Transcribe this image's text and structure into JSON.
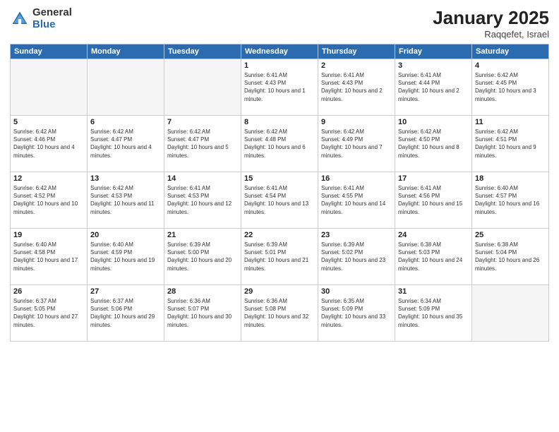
{
  "logo": {
    "general": "General",
    "blue": "Blue"
  },
  "title": {
    "month": "January 2025",
    "location": "Raqqefet, Israel"
  },
  "weekdays": [
    "Sunday",
    "Monday",
    "Tuesday",
    "Wednesday",
    "Thursday",
    "Friday",
    "Saturday"
  ],
  "weeks": [
    [
      {
        "day": "",
        "empty": true
      },
      {
        "day": "",
        "empty": true
      },
      {
        "day": "",
        "empty": true
      },
      {
        "day": "1",
        "sunrise": "6:41 AM",
        "sunset": "4:43 PM",
        "daylight": "10 hours and 1 minute."
      },
      {
        "day": "2",
        "sunrise": "6:41 AM",
        "sunset": "4:43 PM",
        "daylight": "10 hours and 2 minutes."
      },
      {
        "day": "3",
        "sunrise": "6:41 AM",
        "sunset": "4:44 PM",
        "daylight": "10 hours and 2 minutes."
      },
      {
        "day": "4",
        "sunrise": "6:42 AM",
        "sunset": "4:45 PM",
        "daylight": "10 hours and 3 minutes."
      }
    ],
    [
      {
        "day": "5",
        "sunrise": "6:42 AM",
        "sunset": "4:46 PM",
        "daylight": "10 hours and 4 minutes."
      },
      {
        "day": "6",
        "sunrise": "6:42 AM",
        "sunset": "4:47 PM",
        "daylight": "10 hours and 4 minutes."
      },
      {
        "day": "7",
        "sunrise": "6:42 AM",
        "sunset": "4:47 PM",
        "daylight": "10 hours and 5 minutes."
      },
      {
        "day": "8",
        "sunrise": "6:42 AM",
        "sunset": "4:48 PM",
        "daylight": "10 hours and 6 minutes."
      },
      {
        "day": "9",
        "sunrise": "6:42 AM",
        "sunset": "4:49 PM",
        "daylight": "10 hours and 7 minutes."
      },
      {
        "day": "10",
        "sunrise": "6:42 AM",
        "sunset": "4:50 PM",
        "daylight": "10 hours and 8 minutes."
      },
      {
        "day": "11",
        "sunrise": "6:42 AM",
        "sunset": "4:51 PM",
        "daylight": "10 hours and 9 minutes."
      }
    ],
    [
      {
        "day": "12",
        "sunrise": "6:42 AM",
        "sunset": "4:52 PM",
        "daylight": "10 hours and 10 minutes."
      },
      {
        "day": "13",
        "sunrise": "6:42 AM",
        "sunset": "4:53 PM",
        "daylight": "10 hours and 11 minutes."
      },
      {
        "day": "14",
        "sunrise": "6:41 AM",
        "sunset": "4:53 PM",
        "daylight": "10 hours and 12 minutes."
      },
      {
        "day": "15",
        "sunrise": "6:41 AM",
        "sunset": "4:54 PM",
        "daylight": "10 hours and 13 minutes."
      },
      {
        "day": "16",
        "sunrise": "6:41 AM",
        "sunset": "4:55 PM",
        "daylight": "10 hours and 14 minutes."
      },
      {
        "day": "17",
        "sunrise": "6:41 AM",
        "sunset": "4:56 PM",
        "daylight": "10 hours and 15 minutes."
      },
      {
        "day": "18",
        "sunrise": "6:40 AM",
        "sunset": "4:57 PM",
        "daylight": "10 hours and 16 minutes."
      }
    ],
    [
      {
        "day": "19",
        "sunrise": "6:40 AM",
        "sunset": "4:58 PM",
        "daylight": "10 hours and 17 minutes."
      },
      {
        "day": "20",
        "sunrise": "6:40 AM",
        "sunset": "4:59 PM",
        "daylight": "10 hours and 19 minutes."
      },
      {
        "day": "21",
        "sunrise": "6:39 AM",
        "sunset": "5:00 PM",
        "daylight": "10 hours and 20 minutes."
      },
      {
        "day": "22",
        "sunrise": "6:39 AM",
        "sunset": "5:01 PM",
        "daylight": "10 hours and 21 minutes."
      },
      {
        "day": "23",
        "sunrise": "6:39 AM",
        "sunset": "5:02 PM",
        "daylight": "10 hours and 23 minutes."
      },
      {
        "day": "24",
        "sunrise": "6:38 AM",
        "sunset": "5:03 PM",
        "daylight": "10 hours and 24 minutes."
      },
      {
        "day": "25",
        "sunrise": "6:38 AM",
        "sunset": "5:04 PM",
        "daylight": "10 hours and 26 minutes."
      }
    ],
    [
      {
        "day": "26",
        "sunrise": "6:37 AM",
        "sunset": "5:05 PM",
        "daylight": "10 hours and 27 minutes."
      },
      {
        "day": "27",
        "sunrise": "6:37 AM",
        "sunset": "5:06 PM",
        "daylight": "10 hours and 29 minutes."
      },
      {
        "day": "28",
        "sunrise": "6:36 AM",
        "sunset": "5:07 PM",
        "daylight": "10 hours and 30 minutes."
      },
      {
        "day": "29",
        "sunrise": "6:36 AM",
        "sunset": "5:08 PM",
        "daylight": "10 hours and 32 minutes."
      },
      {
        "day": "30",
        "sunrise": "6:35 AM",
        "sunset": "5:09 PM",
        "daylight": "10 hours and 33 minutes."
      },
      {
        "day": "31",
        "sunrise": "6:34 AM",
        "sunset": "5:09 PM",
        "daylight": "10 hours and 35 minutes."
      },
      {
        "day": "",
        "empty": true
      }
    ]
  ],
  "labels": {
    "sunrise": "Sunrise:",
    "sunset": "Sunset:",
    "daylight": "Daylight:"
  }
}
